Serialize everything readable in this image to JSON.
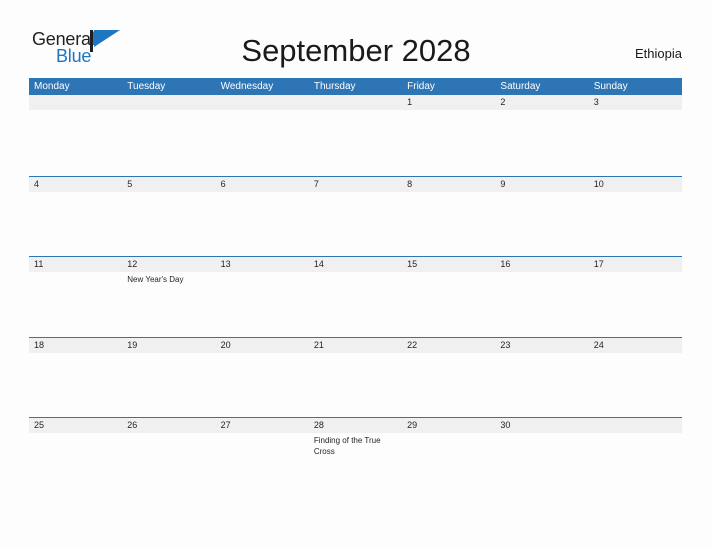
{
  "brand": {
    "name_part1": "General",
    "name_part2": "Blue",
    "flag_icon": "flag-triangle-icon"
  },
  "header": {
    "title": "September 2028",
    "country": "Ethiopia"
  },
  "calendar": {
    "weekdays": [
      "Monday",
      "Tuesday",
      "Wednesday",
      "Thursday",
      "Friday",
      "Saturday",
      "Sunday"
    ],
    "colors": {
      "header_blue": "#2E75B6",
      "band_gray": "#F0F0F0",
      "text_dark": "#231F20",
      "brand_blue": "#1F76C0"
    },
    "weeks": [
      {
        "days": [
          {
            "num": "",
            "events": []
          },
          {
            "num": "",
            "events": []
          },
          {
            "num": "",
            "events": []
          },
          {
            "num": "",
            "events": []
          },
          {
            "num": "1",
            "events": []
          },
          {
            "num": "2",
            "events": []
          },
          {
            "num": "3",
            "events": []
          }
        ]
      },
      {
        "days": [
          {
            "num": "4",
            "events": []
          },
          {
            "num": "5",
            "events": []
          },
          {
            "num": "6",
            "events": []
          },
          {
            "num": "7",
            "events": []
          },
          {
            "num": "8",
            "events": []
          },
          {
            "num": "9",
            "events": []
          },
          {
            "num": "10",
            "events": []
          }
        ]
      },
      {
        "days": [
          {
            "num": "11",
            "events": []
          },
          {
            "num": "12",
            "events": [
              "New Year's Day"
            ]
          },
          {
            "num": "13",
            "events": []
          },
          {
            "num": "14",
            "events": []
          },
          {
            "num": "15",
            "events": []
          },
          {
            "num": "16",
            "events": []
          },
          {
            "num": "17",
            "events": []
          }
        ]
      },
      {
        "days": [
          {
            "num": "18",
            "events": []
          },
          {
            "num": "19",
            "events": []
          },
          {
            "num": "20",
            "events": []
          },
          {
            "num": "21",
            "events": []
          },
          {
            "num": "22",
            "events": []
          },
          {
            "num": "23",
            "events": []
          },
          {
            "num": "24",
            "events": []
          }
        ]
      },
      {
        "days": [
          {
            "num": "25",
            "events": []
          },
          {
            "num": "26",
            "events": []
          },
          {
            "num": "27",
            "events": []
          },
          {
            "num": "28",
            "events": [
              "Finding of the True Cross"
            ]
          },
          {
            "num": "29",
            "events": []
          },
          {
            "num": "30",
            "events": []
          },
          {
            "num": "",
            "events": []
          }
        ]
      }
    ]
  }
}
